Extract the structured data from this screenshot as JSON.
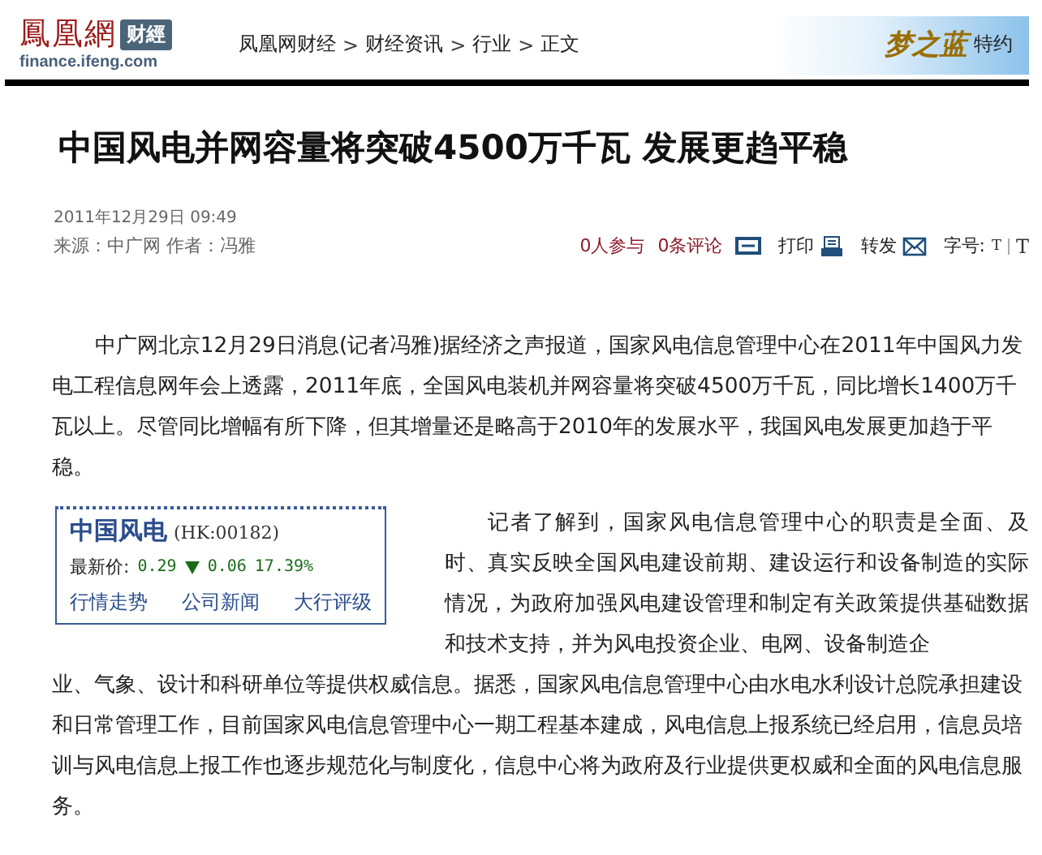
{
  "header": {
    "logo": "鳳凰網",
    "logo_badge": "财經",
    "domain": "finance.ifeng.com",
    "breadcrumb": [
      {
        "label": "凤凰网财经"
      },
      {
        "label": "财经资讯"
      },
      {
        "label": "行业"
      },
      {
        "label": "正文"
      }
    ],
    "separator": ">",
    "sponsor": {
      "brand": "梦之蓝",
      "label": "特约"
    }
  },
  "article": {
    "title": "中国风电并网容量将突破4500万千瓦 发展更趋平稳",
    "date": "2011年12月29日 09:49",
    "source": "来源：中广网 作者：冯雅",
    "actions": {
      "participants": "0人参与",
      "comments": "0条评论",
      "print": "打印",
      "forward": "转发",
      "font_size": "字号:",
      "font_small": "T",
      "font_large": "T"
    },
    "paragraphs": [
      "中广网北京12月29日消息(记者冯雅)据经济之声报道，国家风电信息管理中心在2011年中国风力发电工程信息网年会上透露，2011年底，全国风电装机并网容量将突破4500万千瓦，同比增长1400万千瓦以上。尽管同比增幅有所下降，但其增量还是略高于2010年的发展水平，我国风电发展更加趋于平稳。",
      "记者了解到，国家风电信息管理中心的职责是全面、及时、真实反映全国风电建设前期、建设运行和设备制造的实际情况，为政府加强风电建设管理和制定有关政策提供基础数据和技术支持，并为风电投资企业、电网、设备制造企",
      "业、气象、设计和科研单位等提供权威信息。据悉，国家风电信息管理中心由水电水利设计总院承担建设和日常管理工作，目前国家风电信息管理中心一期工程基本建成，风电信息上报系统已经启用，信息员培训与风电信息上报工作也逐步规范化与制度化，信息中心将为政府及行业提供更权威和全面的风电信息服务。"
    ],
    "stock": {
      "name": "中国风电",
      "code": "(HK:00182)",
      "price_label": "最新价:",
      "price": "0.29",
      "falling": true,
      "change": "0.06",
      "percent": "17.39%",
      "links": [
        "行情走势",
        "公司新闻",
        "大行评级"
      ]
    }
  }
}
